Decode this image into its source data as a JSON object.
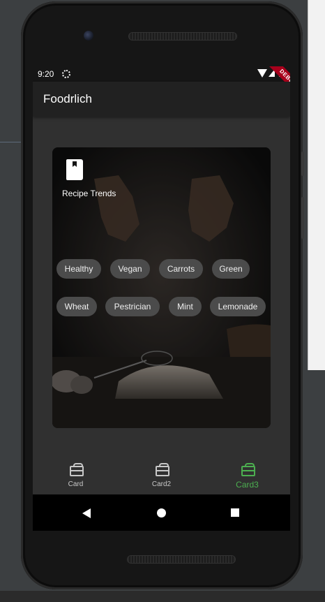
{
  "status_bar": {
    "time": "9:20",
    "debug_label": "DEBUG"
  },
  "app": {
    "title": "Foodrlich"
  },
  "card": {
    "title": "Recipe Trends",
    "chips_row1": [
      "Healthy",
      "Vegan",
      "Carrots",
      "Green"
    ],
    "chips_row2": [
      "Wheat",
      "Pestrician",
      "Mint",
      "Lemonade"
    ]
  },
  "bottom_nav": {
    "items": [
      {
        "label": "Card",
        "icon": "card-icon"
      },
      {
        "label": "Card2",
        "icon": "card-icon"
      },
      {
        "label": "Card3",
        "icon": "card-icon"
      }
    ],
    "selected_index": 2
  },
  "colors": {
    "accent": "#4caf50",
    "appbar": "#212121",
    "screen_bg": "#303030",
    "chip_bg": "#4b4b4b",
    "debug_banner": "#a8001c"
  }
}
